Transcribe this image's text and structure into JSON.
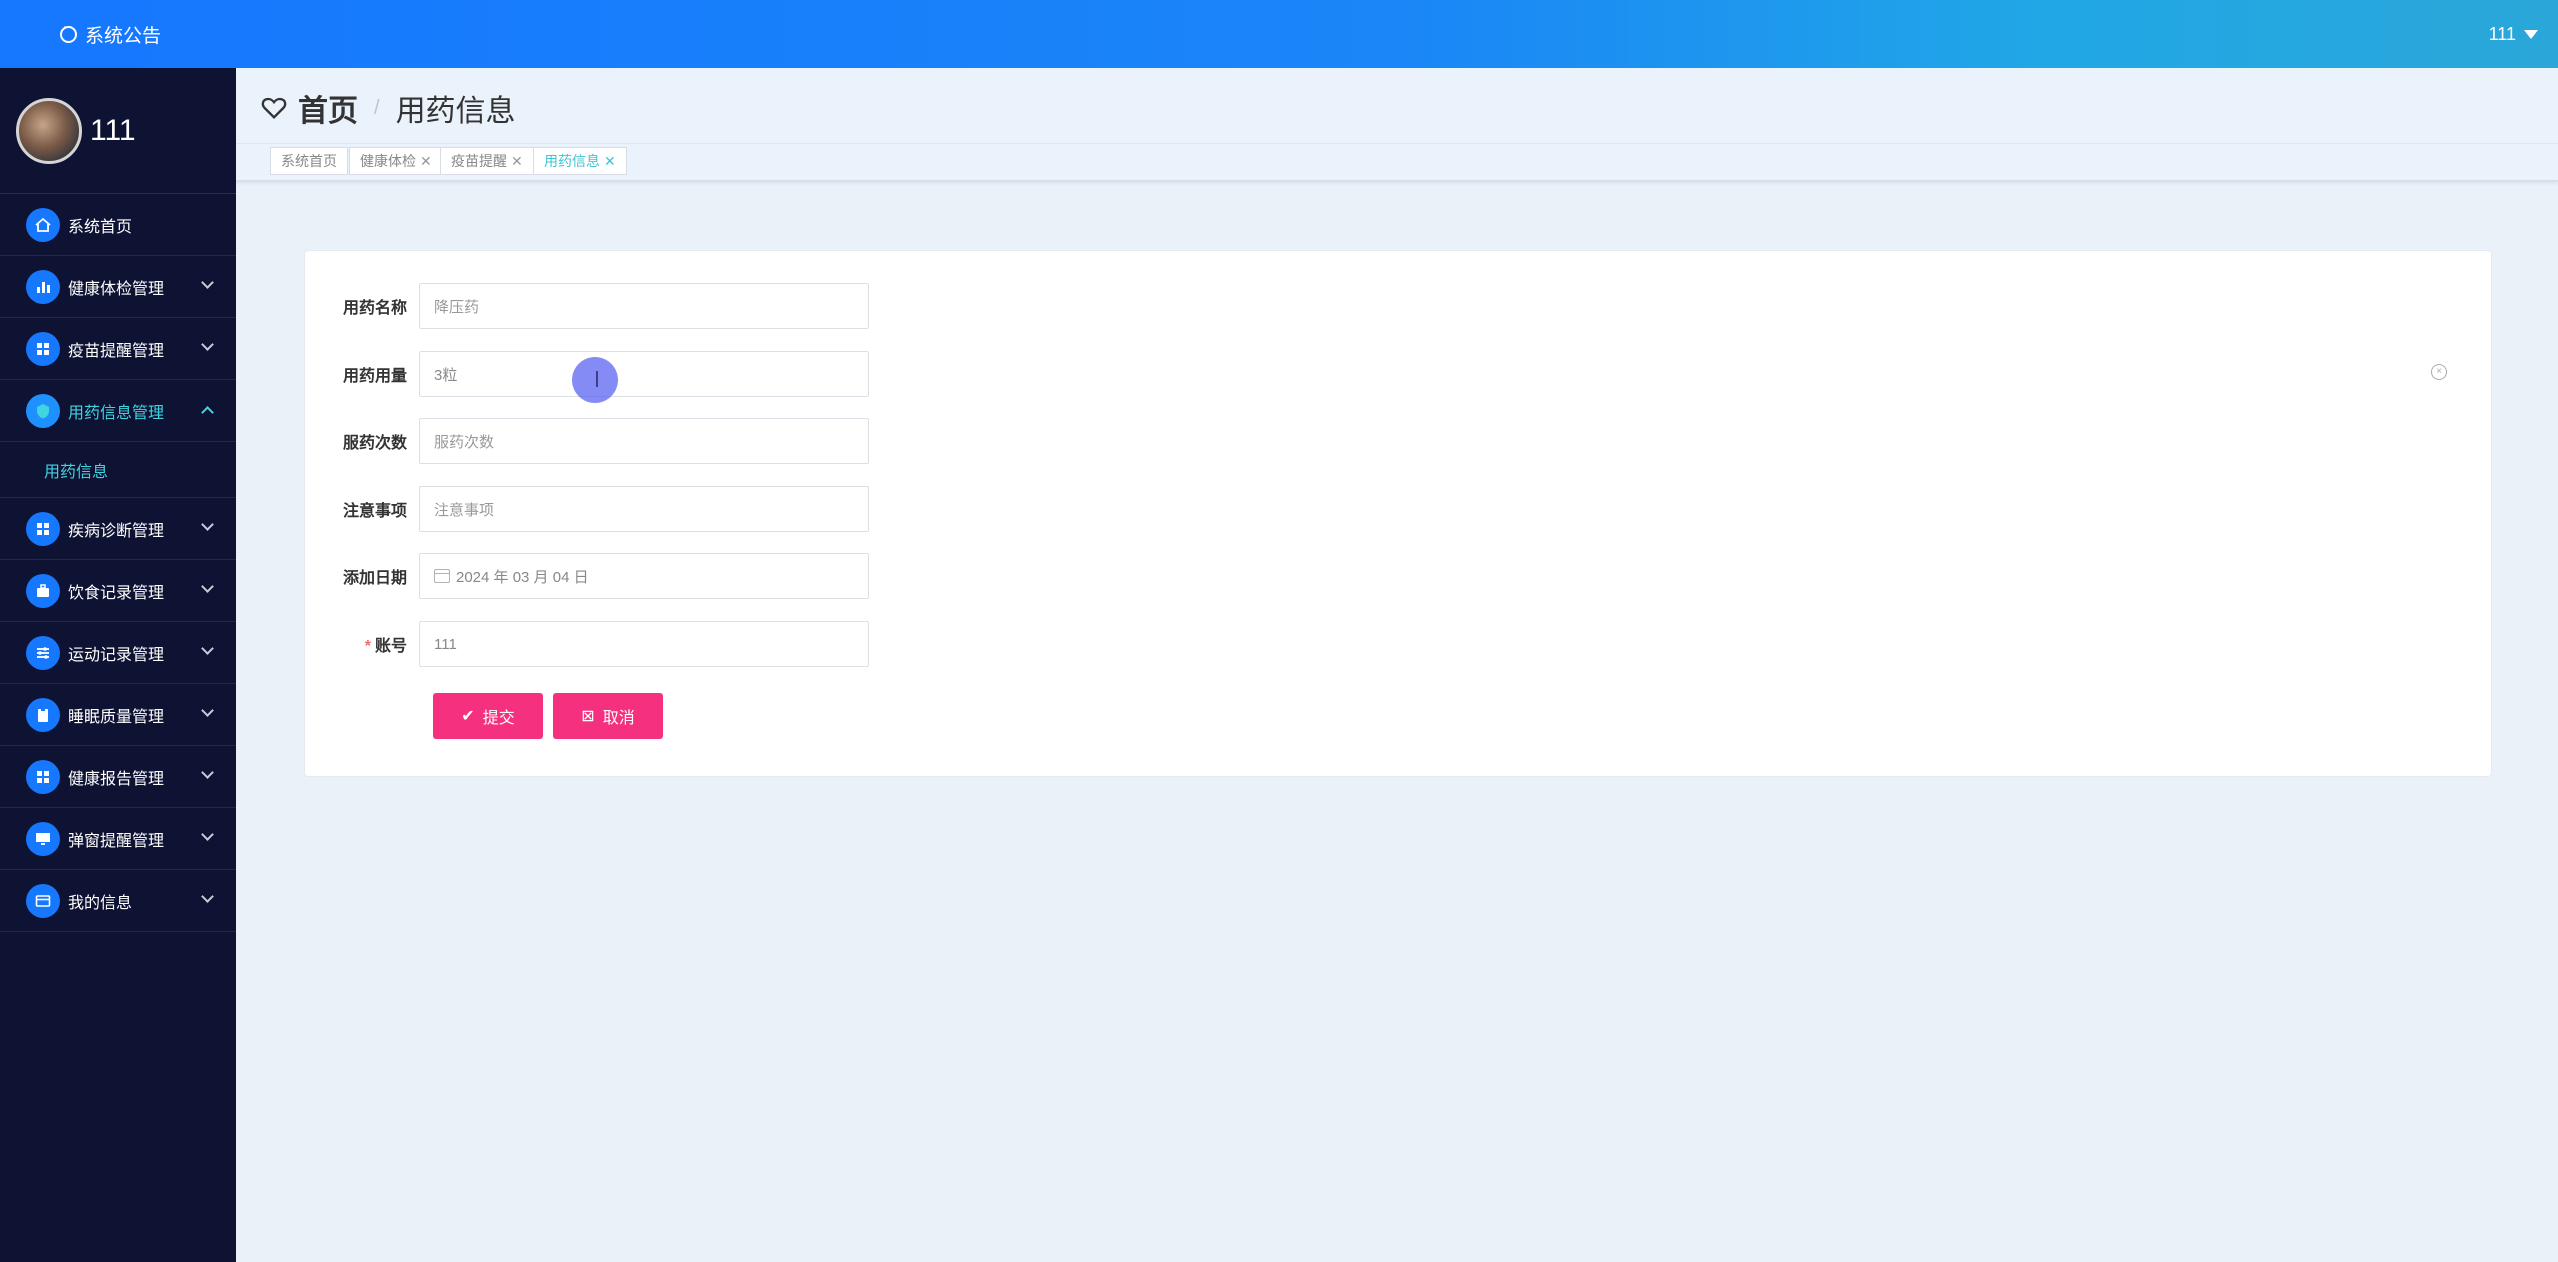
{
  "topbar": {
    "notice": "系统公告",
    "user": "111"
  },
  "profile": {
    "name": "111"
  },
  "sidebar": {
    "items": [
      {
        "label": "系统首页",
        "icon": "home-icon",
        "expandable": false
      },
      {
        "label": "健康体检管理",
        "icon": "bar-chart-icon",
        "expandable": true
      },
      {
        "label": "疫苗提醒管理",
        "icon": "grid-icon",
        "expandable": true
      },
      {
        "label": "用药信息管理",
        "icon": "shield-icon",
        "expandable": true,
        "active": true,
        "sub": [
          "用药信息"
        ]
      },
      {
        "label": "疾病诊断管理",
        "icon": "grid-icon",
        "expandable": true
      },
      {
        "label": "饮食记录管理",
        "icon": "briefcase-icon",
        "expandable": true
      },
      {
        "label": "运动记录管理",
        "icon": "sliders-icon",
        "expandable": true
      },
      {
        "label": "睡眠质量管理",
        "icon": "clipboard-icon",
        "expandable": true
      },
      {
        "label": "健康报告管理",
        "icon": "grid-icon",
        "expandable": true
      },
      {
        "label": "弹窗提醒管理",
        "icon": "monitor-icon",
        "expandable": true
      },
      {
        "label": "我的信息",
        "icon": "card-icon",
        "expandable": true
      }
    ]
  },
  "breadcrumb": {
    "home": "首页",
    "separator": "/",
    "current": "用药信息"
  },
  "tags": [
    {
      "label": "系统首页",
      "closable": false
    },
    {
      "label": "健康体检",
      "closable": true
    },
    {
      "label": "疫苗提醒",
      "closable": true
    },
    {
      "label": "用药信息",
      "closable": true,
      "active": true
    }
  ],
  "form": {
    "fields": [
      {
        "label": "用药名称",
        "placeholder": "降压药",
        "value": ""
      },
      {
        "label": "用药用量",
        "placeholder": "",
        "value": "3粒"
      },
      {
        "label": "服药次数",
        "placeholder": "服药次数",
        "value": ""
      },
      {
        "label": "注意事项",
        "placeholder": "注意事项",
        "value": ""
      },
      {
        "label": "添加日期",
        "placeholder": "",
        "value": "2024 年 03 月 04 日"
      },
      {
        "label": "账号",
        "placeholder": "",
        "value": "111",
        "required": true
      }
    ],
    "submit": "提交",
    "cancel": "取消"
  },
  "colors": {
    "primary": "#1677ff",
    "sidebar_bg": "#0e1233",
    "accent": "#40d4e0",
    "button": "#f5317f"
  }
}
